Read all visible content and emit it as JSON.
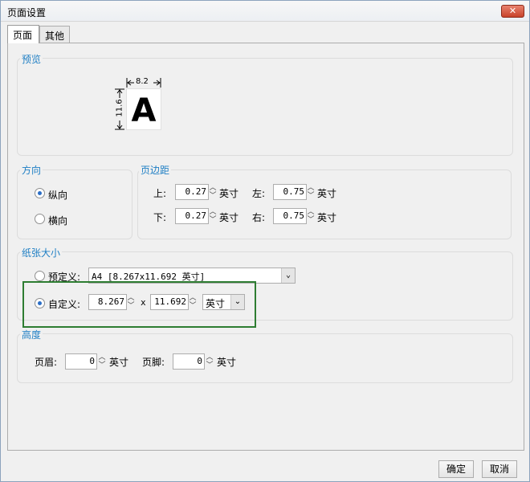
{
  "window": {
    "title": "页面设置",
    "close_label": "✕"
  },
  "tabs": [
    {
      "label": "页面"
    },
    {
      "label": "其他"
    }
  ],
  "preview": {
    "title": "预览",
    "width_label": "8.2",
    "height_label": "11.6",
    "glyph": "A"
  },
  "orientation": {
    "title": "方向",
    "portrait": "纵向",
    "landscape": "横向",
    "selected": "portrait"
  },
  "margins": {
    "title": "页边距",
    "top_label": "上:",
    "top_value": "0.27",
    "top_unit": "英寸",
    "left_label": "左:",
    "left_value": "0.75",
    "left_unit": "英寸",
    "bottom_label": "下:",
    "bottom_value": "0.27",
    "bottom_unit": "英寸",
    "right_label": "右:",
    "right_value": "0.75",
    "right_unit": "英寸"
  },
  "paper": {
    "title": "纸张大小",
    "predefined_label": "预定义:",
    "predefined_value": "A4 [8.267x11.692 英寸]",
    "custom_label": "自定义:",
    "custom_width": "8.267",
    "times": "x",
    "custom_height": "11.692",
    "unit": "英寸",
    "selected": "custom"
  },
  "height": {
    "title": "高度",
    "header_label": "页眉:",
    "header_value": "0",
    "header_unit": "英寸",
    "footer_label": "页脚:",
    "footer_value": "0",
    "footer_unit": "英寸"
  },
  "buttons": {
    "ok": "确定",
    "cancel": "取消"
  },
  "colors": {
    "group_title": "#1f7fc4",
    "highlight": "#2e7d32",
    "radio_dot": "#2b6ec6"
  }
}
